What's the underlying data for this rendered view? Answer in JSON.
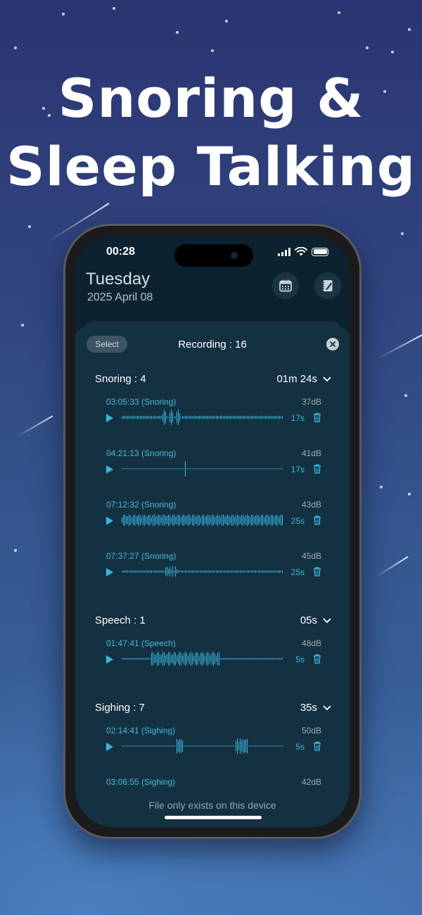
{
  "headline": {
    "line1": "Snoring &",
    "line2": "Sleep Talking"
  },
  "status_bar": {
    "time": "00:28"
  },
  "header": {
    "day": "Tuesday",
    "date": "2025 April 08"
  },
  "sheet": {
    "select_label": "Select",
    "title": "Recording : 16",
    "footer_note": "File only exists on this device"
  },
  "groups": [
    {
      "label": "Snoring : 4",
      "total": "01m 24s",
      "recordings": [
        {
          "name": "03:05:33 (Snoring)",
          "db": "37dB",
          "duration": "17s"
        },
        {
          "name": "04:21:13 (Snoring)",
          "db": "41dB",
          "duration": "17s"
        },
        {
          "name": "07:12:32 (Snoring)",
          "db": "43dB",
          "duration": "25s"
        },
        {
          "name": "07:37:27 (Snoring)",
          "db": "45dB",
          "duration": "25s"
        }
      ]
    },
    {
      "label": "Speech : 1",
      "total": "05s",
      "recordings": [
        {
          "name": "01:47:41 (Speech)",
          "db": "48dB",
          "duration": "5s"
        }
      ]
    },
    {
      "label": "Sighing : 7",
      "total": "35s",
      "recordings": [
        {
          "name": "02:14:41 (Sighing)",
          "db": "50dB",
          "duration": "5s"
        },
        {
          "name": "03:06:55 (Sighing)",
          "db": "42dB",
          "duration": ""
        }
      ]
    }
  ],
  "colors": {
    "accent": "#38b4dd",
    "sheet_bg": "#143142",
    "text_dim": "#9fa9b1"
  },
  "icons": [
    "calendar-icon",
    "notebook-pen-icon",
    "close-icon",
    "chevron-down-icon",
    "play-icon",
    "trash-icon"
  ]
}
